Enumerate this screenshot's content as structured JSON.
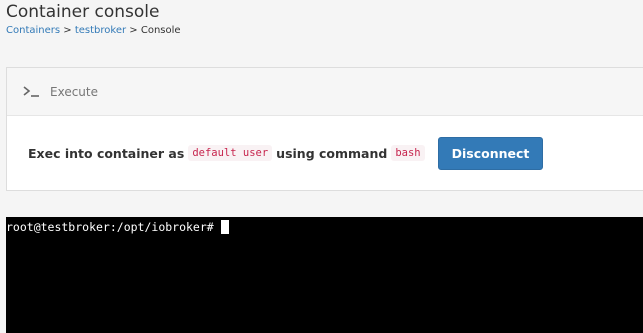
{
  "page": {
    "title": "Container console"
  },
  "breadcrumb": {
    "items": [
      {
        "label": "Containers",
        "link": true
      },
      {
        "label": "testbroker",
        "link": true
      },
      {
        "label": "Console",
        "link": false
      }
    ],
    "separator": ">"
  },
  "execute_panel": {
    "title": "Execute",
    "icon": "terminal-prompt-icon",
    "text_prefix": "Exec into container as",
    "user": "default user",
    "text_middle": "using command",
    "command": "bash",
    "disconnect_label": "Disconnect"
  },
  "terminal": {
    "prompt": "root@testbroker:/opt/iobroker#"
  },
  "colors": {
    "primary_button": "#337ab7",
    "code_text": "#c7254e",
    "terminal_bg": "#000000",
    "link": "#337ab7"
  }
}
